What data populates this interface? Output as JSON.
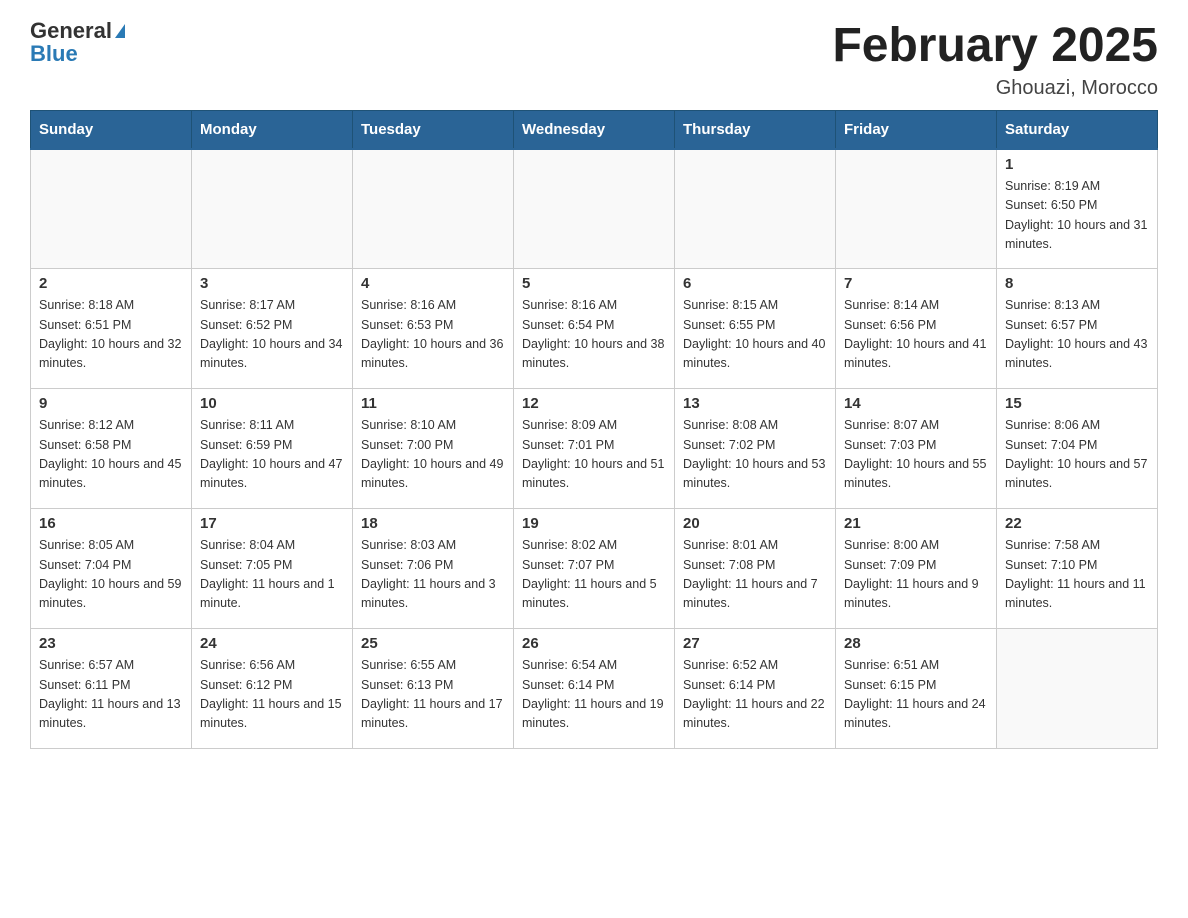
{
  "header": {
    "logo_general": "General",
    "logo_blue": "Blue",
    "month_title": "February 2025",
    "location": "Ghouazi, Morocco"
  },
  "days_of_week": [
    "Sunday",
    "Monday",
    "Tuesday",
    "Wednesday",
    "Thursday",
    "Friday",
    "Saturday"
  ],
  "weeks": [
    [
      {
        "day": "",
        "sunrise": "",
        "sunset": "",
        "daylight": ""
      },
      {
        "day": "",
        "sunrise": "",
        "sunset": "",
        "daylight": ""
      },
      {
        "day": "",
        "sunrise": "",
        "sunset": "",
        "daylight": ""
      },
      {
        "day": "",
        "sunrise": "",
        "sunset": "",
        "daylight": ""
      },
      {
        "day": "",
        "sunrise": "",
        "sunset": "",
        "daylight": ""
      },
      {
        "day": "",
        "sunrise": "",
        "sunset": "",
        "daylight": ""
      },
      {
        "day": "1",
        "sunrise": "Sunrise: 8:19 AM",
        "sunset": "Sunset: 6:50 PM",
        "daylight": "Daylight: 10 hours and 31 minutes."
      }
    ],
    [
      {
        "day": "2",
        "sunrise": "Sunrise: 8:18 AM",
        "sunset": "Sunset: 6:51 PM",
        "daylight": "Daylight: 10 hours and 32 minutes."
      },
      {
        "day": "3",
        "sunrise": "Sunrise: 8:17 AM",
        "sunset": "Sunset: 6:52 PM",
        "daylight": "Daylight: 10 hours and 34 minutes."
      },
      {
        "day": "4",
        "sunrise": "Sunrise: 8:16 AM",
        "sunset": "Sunset: 6:53 PM",
        "daylight": "Daylight: 10 hours and 36 minutes."
      },
      {
        "day": "5",
        "sunrise": "Sunrise: 8:16 AM",
        "sunset": "Sunset: 6:54 PM",
        "daylight": "Daylight: 10 hours and 38 minutes."
      },
      {
        "day": "6",
        "sunrise": "Sunrise: 8:15 AM",
        "sunset": "Sunset: 6:55 PM",
        "daylight": "Daylight: 10 hours and 40 minutes."
      },
      {
        "day": "7",
        "sunrise": "Sunrise: 8:14 AM",
        "sunset": "Sunset: 6:56 PM",
        "daylight": "Daylight: 10 hours and 41 minutes."
      },
      {
        "day": "8",
        "sunrise": "Sunrise: 8:13 AM",
        "sunset": "Sunset: 6:57 PM",
        "daylight": "Daylight: 10 hours and 43 minutes."
      }
    ],
    [
      {
        "day": "9",
        "sunrise": "Sunrise: 8:12 AM",
        "sunset": "Sunset: 6:58 PM",
        "daylight": "Daylight: 10 hours and 45 minutes."
      },
      {
        "day": "10",
        "sunrise": "Sunrise: 8:11 AM",
        "sunset": "Sunset: 6:59 PM",
        "daylight": "Daylight: 10 hours and 47 minutes."
      },
      {
        "day": "11",
        "sunrise": "Sunrise: 8:10 AM",
        "sunset": "Sunset: 7:00 PM",
        "daylight": "Daylight: 10 hours and 49 minutes."
      },
      {
        "day": "12",
        "sunrise": "Sunrise: 8:09 AM",
        "sunset": "Sunset: 7:01 PM",
        "daylight": "Daylight: 10 hours and 51 minutes."
      },
      {
        "day": "13",
        "sunrise": "Sunrise: 8:08 AM",
        "sunset": "Sunset: 7:02 PM",
        "daylight": "Daylight: 10 hours and 53 minutes."
      },
      {
        "day": "14",
        "sunrise": "Sunrise: 8:07 AM",
        "sunset": "Sunset: 7:03 PM",
        "daylight": "Daylight: 10 hours and 55 minutes."
      },
      {
        "day": "15",
        "sunrise": "Sunrise: 8:06 AM",
        "sunset": "Sunset: 7:04 PM",
        "daylight": "Daylight: 10 hours and 57 minutes."
      }
    ],
    [
      {
        "day": "16",
        "sunrise": "Sunrise: 8:05 AM",
        "sunset": "Sunset: 7:04 PM",
        "daylight": "Daylight: 10 hours and 59 minutes."
      },
      {
        "day": "17",
        "sunrise": "Sunrise: 8:04 AM",
        "sunset": "Sunset: 7:05 PM",
        "daylight": "Daylight: 11 hours and 1 minute."
      },
      {
        "day": "18",
        "sunrise": "Sunrise: 8:03 AM",
        "sunset": "Sunset: 7:06 PM",
        "daylight": "Daylight: 11 hours and 3 minutes."
      },
      {
        "day": "19",
        "sunrise": "Sunrise: 8:02 AM",
        "sunset": "Sunset: 7:07 PM",
        "daylight": "Daylight: 11 hours and 5 minutes."
      },
      {
        "day": "20",
        "sunrise": "Sunrise: 8:01 AM",
        "sunset": "Sunset: 7:08 PM",
        "daylight": "Daylight: 11 hours and 7 minutes."
      },
      {
        "day": "21",
        "sunrise": "Sunrise: 8:00 AM",
        "sunset": "Sunset: 7:09 PM",
        "daylight": "Daylight: 11 hours and 9 minutes."
      },
      {
        "day": "22",
        "sunrise": "Sunrise: 7:58 AM",
        "sunset": "Sunset: 7:10 PM",
        "daylight": "Daylight: 11 hours and 11 minutes."
      }
    ],
    [
      {
        "day": "23",
        "sunrise": "Sunrise: 6:57 AM",
        "sunset": "Sunset: 6:11 PM",
        "daylight": "Daylight: 11 hours and 13 minutes."
      },
      {
        "day": "24",
        "sunrise": "Sunrise: 6:56 AM",
        "sunset": "Sunset: 6:12 PM",
        "daylight": "Daylight: 11 hours and 15 minutes."
      },
      {
        "day": "25",
        "sunrise": "Sunrise: 6:55 AM",
        "sunset": "Sunset: 6:13 PM",
        "daylight": "Daylight: 11 hours and 17 minutes."
      },
      {
        "day": "26",
        "sunrise": "Sunrise: 6:54 AM",
        "sunset": "Sunset: 6:14 PM",
        "daylight": "Daylight: 11 hours and 19 minutes."
      },
      {
        "day": "27",
        "sunrise": "Sunrise: 6:52 AM",
        "sunset": "Sunset: 6:14 PM",
        "daylight": "Daylight: 11 hours and 22 minutes."
      },
      {
        "day": "28",
        "sunrise": "Sunrise: 6:51 AM",
        "sunset": "Sunset: 6:15 PM",
        "daylight": "Daylight: 11 hours and 24 minutes."
      },
      {
        "day": "",
        "sunrise": "",
        "sunset": "",
        "daylight": ""
      }
    ]
  ]
}
